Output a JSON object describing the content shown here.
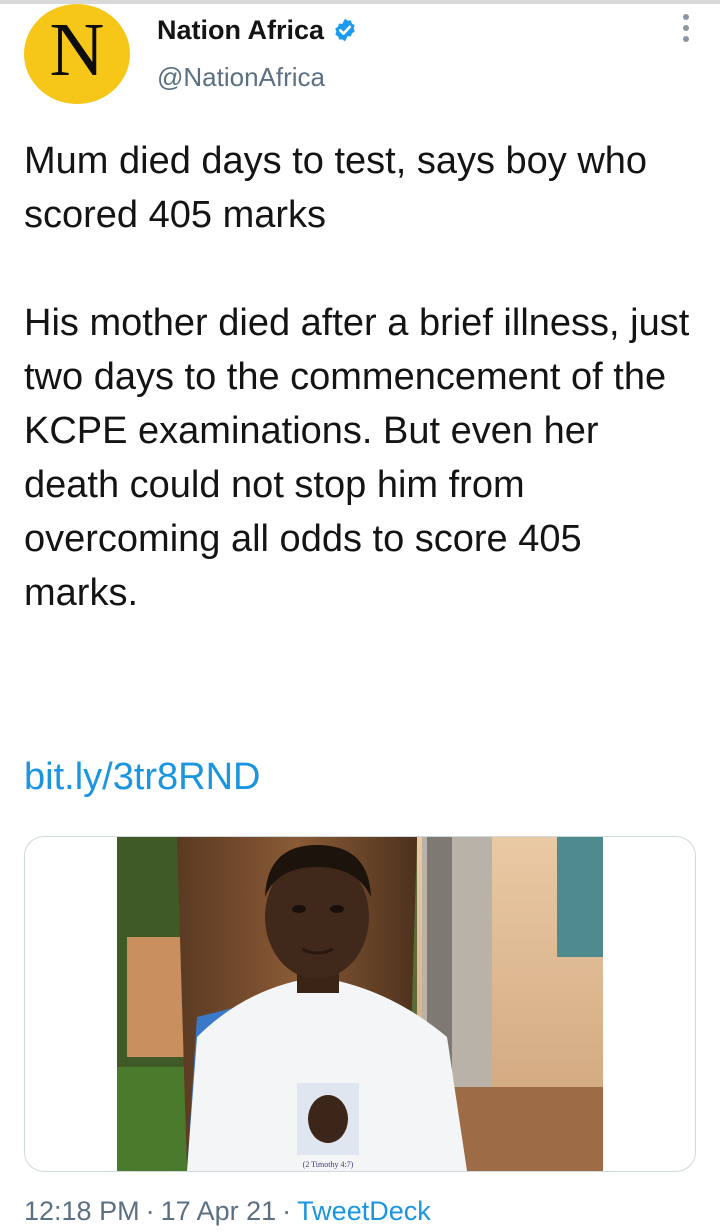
{
  "tweet": {
    "avatar_letter": "N",
    "display_name": "Nation Africa",
    "handle": "@NationAfrica",
    "text_paragraphs": [
      "Mum died days to test, says boy who scored 405 marks",
      "His mother died after a brief illness, just two days to the commencement of the KCPE examinations. But even her death could not stop him from overcoming all odds to score 405 marks."
    ],
    "link": "bit.ly/3tr8RND",
    "shirt_print": "(2 Timothy 4:7)",
    "time": "12:18 PM",
    "date": "17 Apr 21",
    "separator": "·",
    "source": "TweetDeck"
  },
  "colors": {
    "avatar_bg": "#f6c619",
    "verified": "#1d9bf0",
    "link": "#1b95e0",
    "secondary_text": "#5b7083"
  },
  "icons": {
    "verified": "verified-badge-icon",
    "more": "more-vertical-icon"
  }
}
